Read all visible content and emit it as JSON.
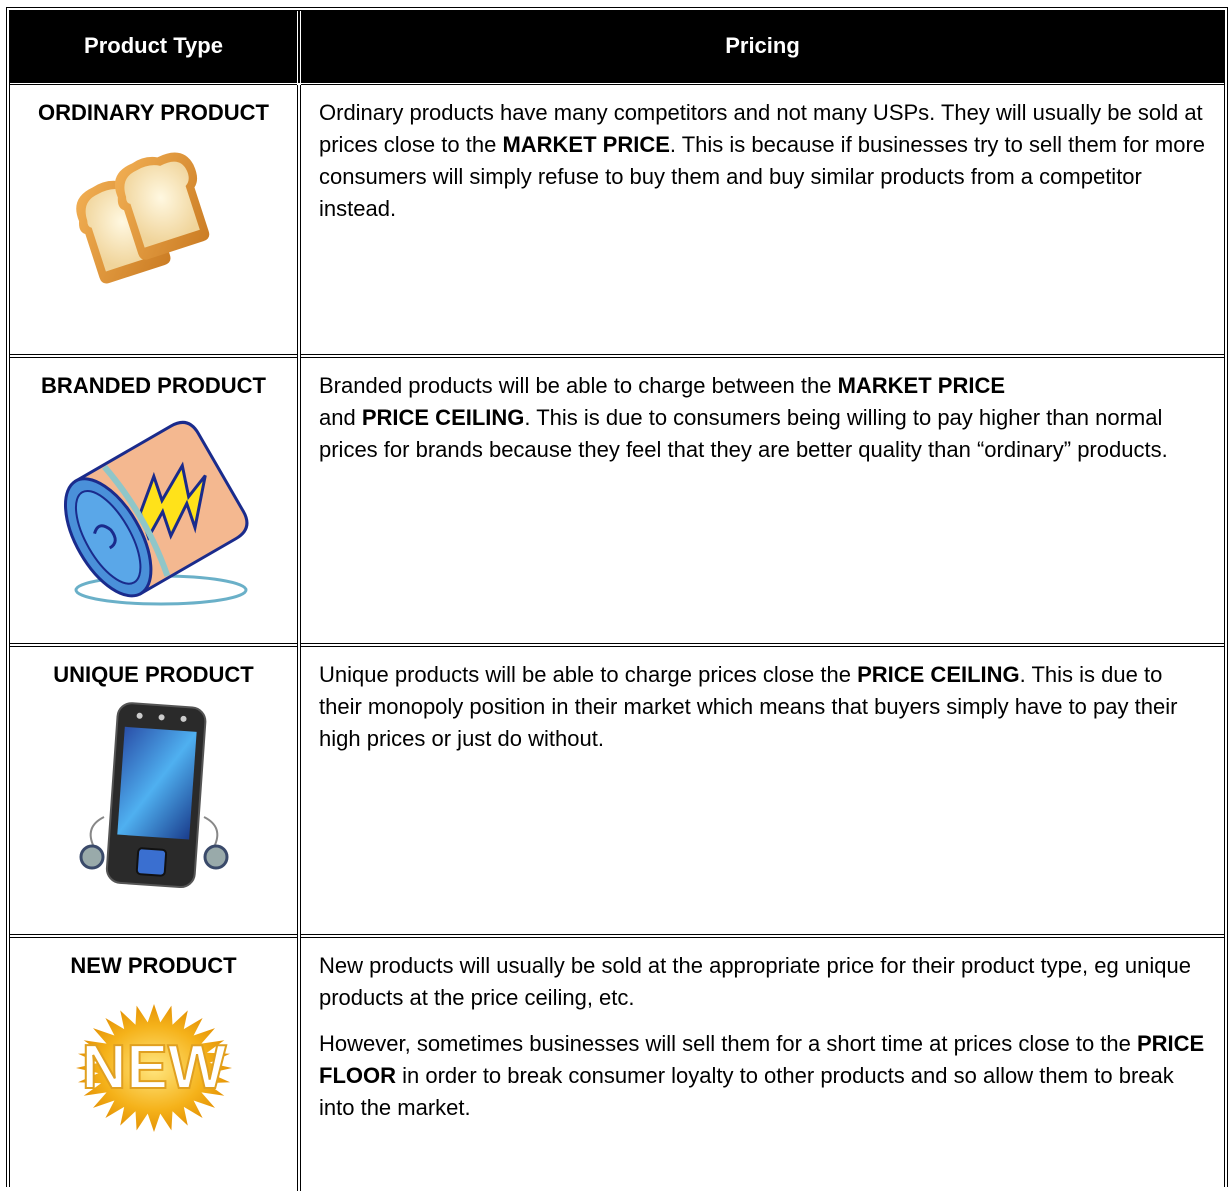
{
  "header": {
    "col1": "Product Type",
    "col2": "Pricing"
  },
  "rows": [
    {
      "name": "ORDINARY PRODUCT",
      "icon": "bread-icon",
      "p1_a": "Ordinary products have many competitors and not many USPs.  They will usually be sold at prices close to the ",
      "p1_b": "MARKET PRICE",
      "p1_c": ".  This is because if businesses try to sell them for more consumers will simply refuse to buy them and buy similar products from a competitor instead."
    },
    {
      "name": "BRANDED PRODUCT",
      "icon": "energy-can-icon",
      "p1_a": "Branded products will be able to charge between the ",
      "p1_b": "MARKET PRICE",
      "p1_c": " and ",
      "p1_d": "PRICE CEILING",
      "p1_e": ".  This is due to consumers being willing to pay higher than normal prices for brands because they feel that they are better quality than “ordinary” products."
    },
    {
      "name": "UNIQUE PRODUCT",
      "icon": "smartphone-icon",
      "p1_a": "Unique products will be able to charge prices close the ",
      "p1_b": "PRICE CEILING",
      "p1_c": ".  This is due to their monopoly position in their market which means that buyers simply have to pay their high prices or just do without."
    },
    {
      "name": "NEW PRODUCT",
      "icon": "new-starburst-icon",
      "badge_text": "NEW",
      "p1": "New products will usually be sold at the appropriate price for their product type, eg unique products at the price ceiling, etc.",
      "p2_a": "However, sometimes businesses will sell them for a short time at prices close to the ",
      "p2_b": "PRICE FLOOR",
      "p2_c": " in order to break consumer loyalty to other products and so allow them to break into the market."
    }
  ],
  "colors": {
    "header_bg": "#000000",
    "header_text": "#ffffff"
  }
}
